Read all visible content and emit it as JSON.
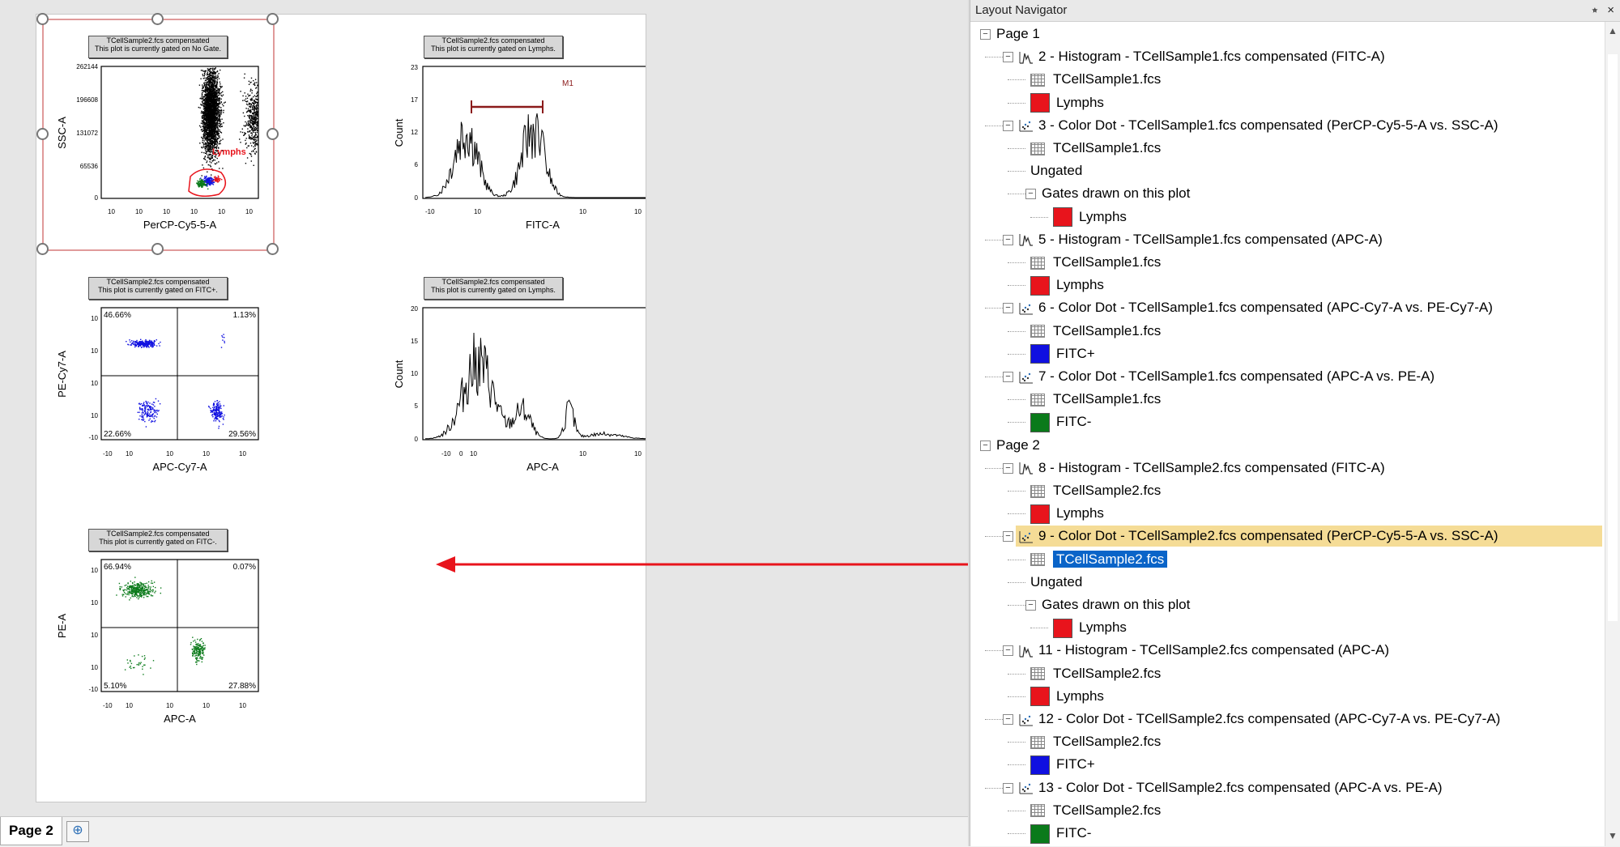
{
  "layout": {
    "page_tab": "Page 2",
    "plots": [
      {
        "banner": [
          "TCellSample2.fcs compensated",
          "This plot is currently gated on No Gate."
        ],
        "xlabel": "PerCP-Cy5-5-A",
        "ylabel": "SSC-A",
        "yticks": [
          "262144",
          "196608",
          "131072",
          "65536",
          "0"
        ],
        "xticks": [
          "10",
          "10",
          "10",
          "10",
          "10",
          "10"
        ],
        "gate": "Lymphs"
      },
      {
        "banner": [
          "TCellSample2.fcs compensated",
          "This plot is currently gated on Lymphs."
        ],
        "xlabel": "FITC-A",
        "ylabel": "Count",
        "yticks": [
          "23",
          "17",
          "12",
          "6",
          "0"
        ],
        "xticks": [
          "-10",
          "10",
          "10",
          "10"
        ],
        "marker": "M1"
      },
      {
        "banner": [
          "TCellSample2.fcs compensated",
          "This plot is currently gated on FITC+."
        ],
        "xlabel": "APC-Cy7-A",
        "ylabel": "PE-Cy7-A",
        "quad": [
          "46.66%",
          "1.13%",
          "22.66%",
          "29.56%"
        ],
        "yticks": [
          "10",
          "10",
          "10",
          "10",
          "-10"
        ],
        "xticks": [
          "-10",
          "10",
          "10",
          "10",
          "10"
        ]
      },
      {
        "banner": [
          "TCellSample2.fcs compensated",
          "This plot is currently gated on Lymphs."
        ],
        "xlabel": "APC-A",
        "ylabel": "Count",
        "yticks": [
          "20",
          "15",
          "10",
          "5",
          "0"
        ],
        "xticks": [
          "-10",
          "0",
          "10",
          "10",
          "10"
        ]
      },
      {
        "banner": [
          "TCellSample2.fcs compensated",
          "This plot is currently gated on FITC-."
        ],
        "xlabel": "APC-A",
        "ylabel": "PE-A",
        "quad": [
          "66.94%",
          "0.07%",
          "5.10%",
          "27.88%"
        ],
        "yticks": [
          "10",
          "10",
          "10",
          "10",
          "-10"
        ],
        "xticks": [
          "-10",
          "10",
          "10",
          "10",
          "10"
        ]
      }
    ]
  },
  "navigator": {
    "title": "Layout Navigator",
    "pin": "⭒",
    "close": "×",
    "colors": {
      "red": "#e8141c",
      "blue": "#1010e0",
      "green": "#0a7a1a"
    },
    "rows": [
      {
        "indent": 0,
        "exp": "minus",
        "text": "Page 1"
      },
      {
        "indent": 1,
        "exp": "minus",
        "icon": "histogram-icon",
        "text": "2 - Histogram - TCellSample1.fcs compensated (FITC-A)"
      },
      {
        "indent": 2,
        "icon": "grid-icon",
        "text": "TCellSample1.fcs"
      },
      {
        "indent": 2,
        "color": "red",
        "text": "Lymphs"
      },
      {
        "indent": 1,
        "exp": "minus",
        "icon": "dotplot-icon",
        "text": "3 - Color Dot - TCellSample1.fcs compensated (PerCP-Cy5-5-A vs. SSC-A)"
      },
      {
        "indent": 2,
        "icon": "grid-icon",
        "text": "TCellSample1.fcs"
      },
      {
        "indent": 2,
        "text": "Ungated"
      },
      {
        "indent": 2,
        "exp": "minus",
        "text": "Gates drawn on this plot"
      },
      {
        "indent": 3,
        "color": "red",
        "text": "Lymphs"
      },
      {
        "indent": 1,
        "exp": "minus",
        "icon": "histogram-icon",
        "text": "5 - Histogram - TCellSample1.fcs compensated (APC-A)"
      },
      {
        "indent": 2,
        "icon": "grid-icon",
        "text": "TCellSample1.fcs"
      },
      {
        "indent": 2,
        "color": "red",
        "text": "Lymphs"
      },
      {
        "indent": 1,
        "exp": "minus",
        "icon": "dotplot-icon",
        "text": "6 - Color Dot - TCellSample1.fcs compensated (APC-Cy7-A vs. PE-Cy7-A)"
      },
      {
        "indent": 2,
        "icon": "grid-icon",
        "text": "TCellSample1.fcs"
      },
      {
        "indent": 2,
        "color": "blue",
        "text": "FITC+"
      },
      {
        "indent": 1,
        "exp": "minus",
        "icon": "dotplot-icon",
        "text": "7 - Color Dot - TCellSample1.fcs compensated (APC-A vs. PE-A)"
      },
      {
        "indent": 2,
        "icon": "grid-icon",
        "text": "TCellSample1.fcs"
      },
      {
        "indent": 2,
        "color": "green",
        "text": "FITC-"
      },
      {
        "indent": 0,
        "exp": "minus",
        "text": "Page 2"
      },
      {
        "indent": 1,
        "exp": "minus",
        "icon": "histogram-icon",
        "text": "8 - Histogram - TCellSample2.fcs compensated (FITC-A)"
      },
      {
        "indent": 2,
        "icon": "grid-icon",
        "text": "TCellSample2.fcs"
      },
      {
        "indent": 2,
        "color": "red",
        "text": "Lymphs"
      },
      {
        "indent": 1,
        "exp": "minus",
        "icon": "dotplot-icon",
        "text": "9 - Color Dot - TCellSample2.fcs compensated (PerCP-Cy5-5-A vs. SSC-A)",
        "highlight": true
      },
      {
        "indent": 2,
        "icon": "grid-icon",
        "text": "TCellSample2.fcs",
        "selected": true
      },
      {
        "indent": 2,
        "text": "Ungated"
      },
      {
        "indent": 2,
        "exp": "minus",
        "text": "Gates drawn on this plot"
      },
      {
        "indent": 3,
        "color": "red",
        "text": "Lymphs"
      },
      {
        "indent": 1,
        "exp": "minus",
        "icon": "histogram-icon",
        "text": "11 - Histogram - TCellSample2.fcs compensated (APC-A)"
      },
      {
        "indent": 2,
        "icon": "grid-icon",
        "text": "TCellSample2.fcs"
      },
      {
        "indent": 2,
        "color": "red",
        "text": "Lymphs"
      },
      {
        "indent": 1,
        "exp": "minus",
        "icon": "dotplot-icon",
        "text": "12 - Color Dot - TCellSample2.fcs compensated (APC-Cy7-A vs. PE-Cy7-A)"
      },
      {
        "indent": 2,
        "icon": "grid-icon",
        "text": "TCellSample2.fcs"
      },
      {
        "indent": 2,
        "color": "blue",
        "text": "FITC+"
      },
      {
        "indent": 1,
        "exp": "minus",
        "icon": "dotplot-icon",
        "text": "13 - Color Dot - TCellSample2.fcs compensated (APC-A vs. PE-A)"
      },
      {
        "indent": 2,
        "icon": "grid-icon",
        "text": "TCellSample2.fcs"
      },
      {
        "indent": 2,
        "color": "green",
        "text": "FITC-"
      }
    ]
  }
}
